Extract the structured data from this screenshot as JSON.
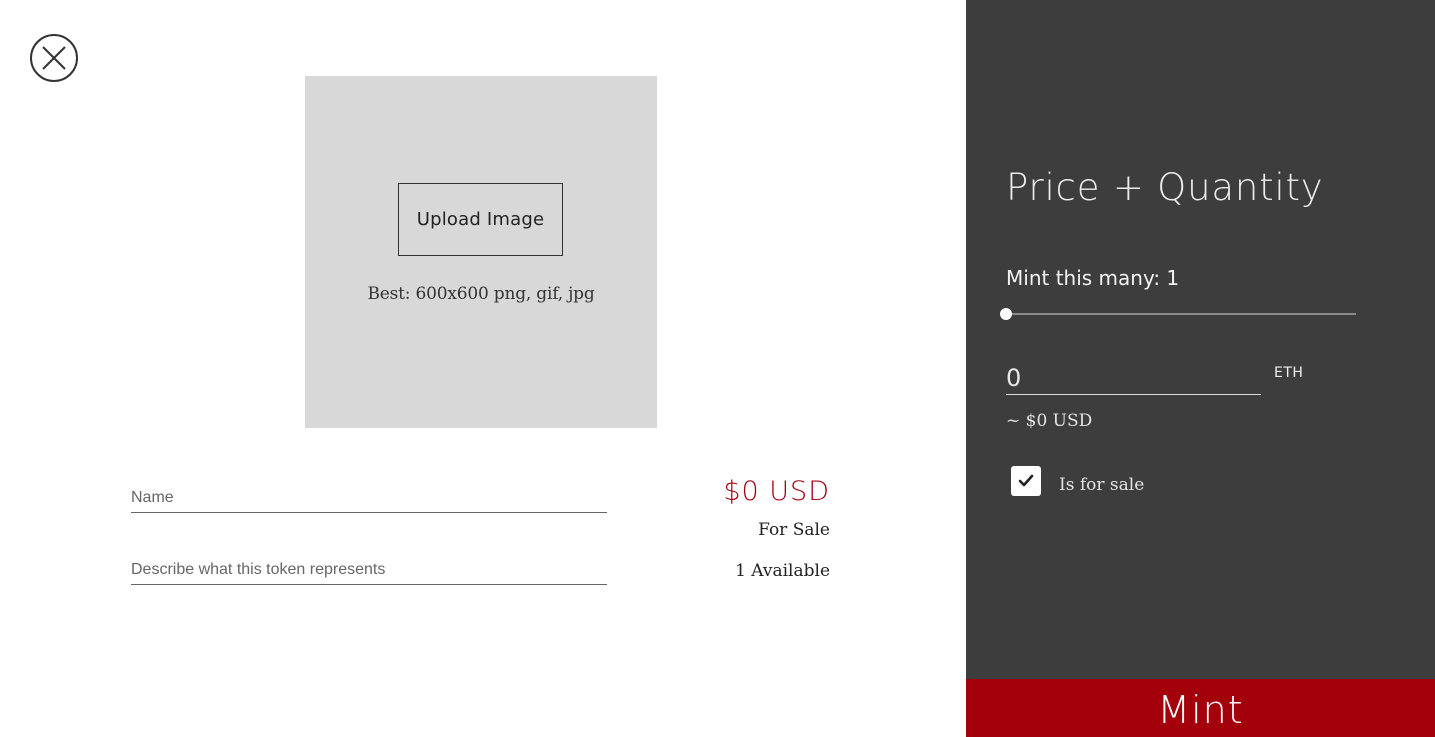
{
  "close": {
    "icon": "close-icon"
  },
  "upload": {
    "button_label": "Upload Image",
    "hint": "Best: 600x600 png, gif, jpg",
    "placeholder_color": "#d8d8d8"
  },
  "form": {
    "name_placeholder": "Name",
    "description_placeholder": "Describe what this token represents"
  },
  "summary": {
    "price_usd": "$0 USD",
    "sale_status": "For Sale",
    "availability": "1 Available"
  },
  "panel": {
    "title": "Price + Quantity",
    "mint_count_label": "Mint this many: 1",
    "quantity_slider": {
      "value": 1,
      "level": 0
    },
    "price_value": "0",
    "price_unit": "ETH",
    "usd_equivalent": "~ $0 USD",
    "for_sale_checked": true,
    "for_sale_label": "Is for sale",
    "background_color": "#3d3d3d"
  },
  "mint": {
    "label": "Mint",
    "color": "#a3000b"
  },
  "colors": {
    "accent": "#a4000f"
  }
}
